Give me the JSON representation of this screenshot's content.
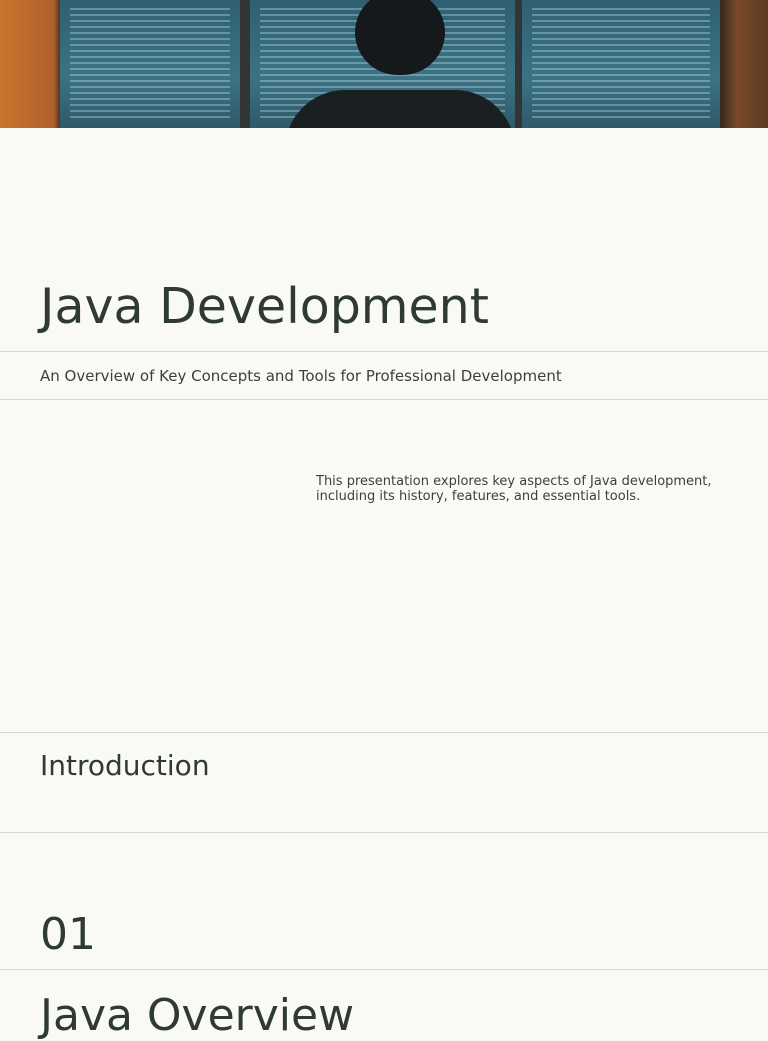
{
  "hero": {
    "image": "developer-at-monitors-photo"
  },
  "title": "Java Development",
  "subtitle": "An Overview of Key Concepts and Tools for Professional Development",
  "description": "This presentation explores key aspects of Java development, including its history, features, and essential tools.",
  "sections": [
    {
      "label": "Introduction"
    },
    {
      "number": "01",
      "heading": "Java Overview"
    }
  ]
}
